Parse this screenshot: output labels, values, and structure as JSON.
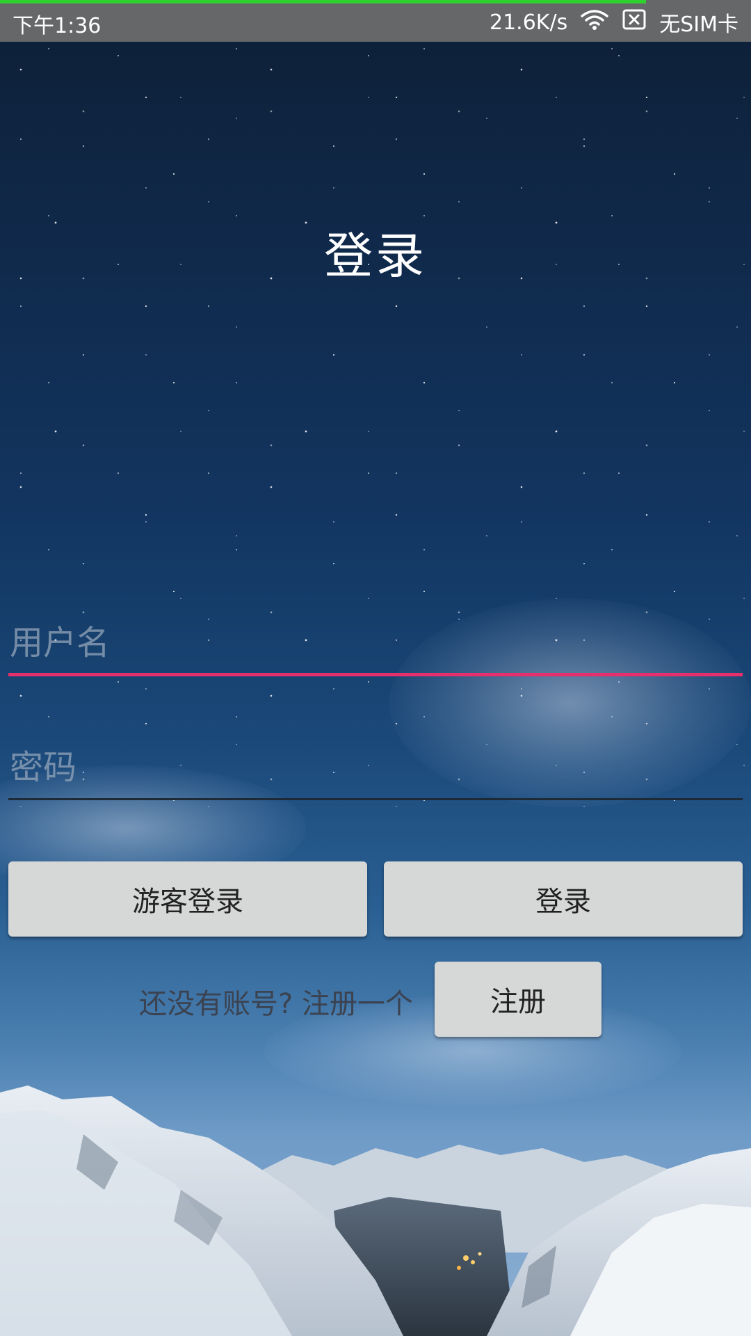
{
  "status_bar": {
    "time": "下午1:36",
    "net_speed": "21.6K/s",
    "sim": "无SIM卡",
    "wifi_icon": "wifi-icon",
    "no_sim_icon": "sim-card-x-icon",
    "progress": 0.86,
    "progress_color": "#2fd12f"
  },
  "screen": {
    "title": "登录"
  },
  "form": {
    "username_placeholder": "用户名",
    "password_placeholder": "密码",
    "username_underline_color": "#e6306e"
  },
  "buttons": {
    "guest_login": "游客登录",
    "login": "登录",
    "register": "注册"
  },
  "register_hint": "还没有账号? 注册一个"
}
